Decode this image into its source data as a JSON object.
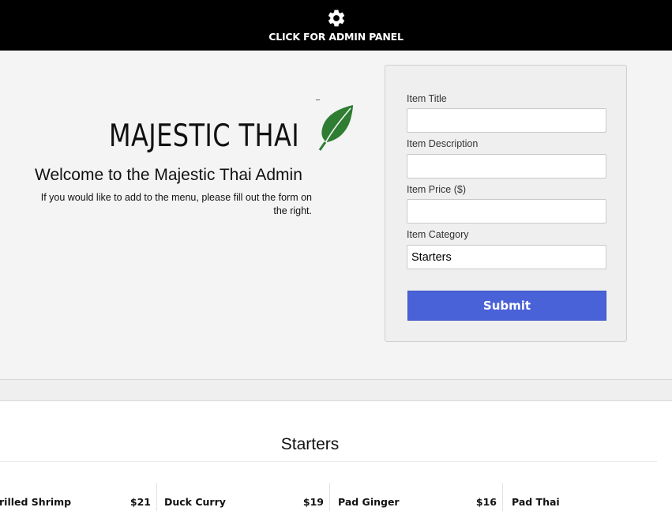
{
  "topbar": {
    "icon": "gear-icon",
    "admin_label": "CLICK FOR ADMIN PANEL"
  },
  "hero": {
    "logo_text": "MAJESTIC THAI",
    "logo_icon": "leaf-icon",
    "welcome_title": "Welcome to the Majestic Thai Admin",
    "intro_text": "If you would like to add to the menu, please fill out the form on the right."
  },
  "form": {
    "title_label": "Item Title",
    "title_value": "",
    "description_label": "Item Description",
    "description_value": "",
    "price_label": "Item Price ($)",
    "price_value": "",
    "category_label": "Item Category",
    "category_value": "Starters",
    "submit_label": "Submit"
  },
  "menu": {
    "section_title": "Starters",
    "items": [
      {
        "name": "rilled Shrimp",
        "price": "$21"
      },
      {
        "name": "Duck Curry",
        "price": "$19"
      },
      {
        "name": "Pad Ginger",
        "price": "$16"
      },
      {
        "name": "Pad Thai",
        "price": ""
      }
    ]
  },
  "colors": {
    "topbar_bg": "#000000",
    "hero_bg": "#f4f4f4",
    "submit_bg": "#4a62d8",
    "leaf_green": "#2e7d32"
  }
}
